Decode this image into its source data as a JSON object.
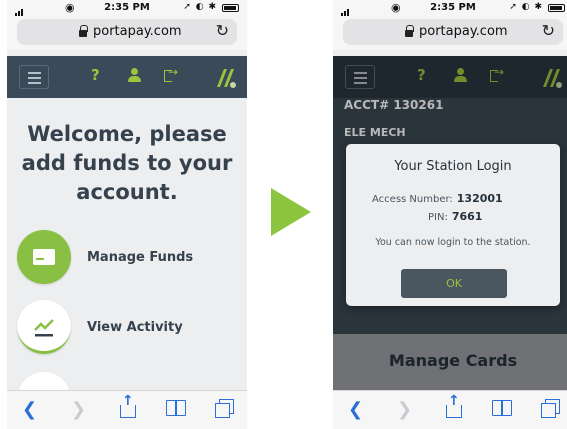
{
  "status_bar": {
    "time": "2:35 PM"
  },
  "browser": {
    "url": "portapay.com"
  },
  "nav": {
    "help_label": "?"
  },
  "left_screen": {
    "welcome_line1": "Welcome, please",
    "welcome_line2": "add funds to your",
    "welcome_line3": "account.",
    "actions": [
      {
        "label": "Manage Funds",
        "icon": "card-icon"
      },
      {
        "label": "View Activity",
        "icon": "trend-icon"
      }
    ]
  },
  "right_screen": {
    "account": "ACCT# 130261",
    "account_name": "ELE MECH",
    "section_title": "Manage Cards",
    "dialog": {
      "title": "Your Station Login",
      "access_label": "Access Number:",
      "access_value": "132001",
      "pin_label": "PIN:",
      "pin_value": "7661",
      "message": "You can now login to the station.",
      "ok_label": "OK"
    }
  },
  "colors": {
    "accent": "#8bc53f",
    "nav": "#3a4a58",
    "ios_blue": "#2a6fd8"
  }
}
